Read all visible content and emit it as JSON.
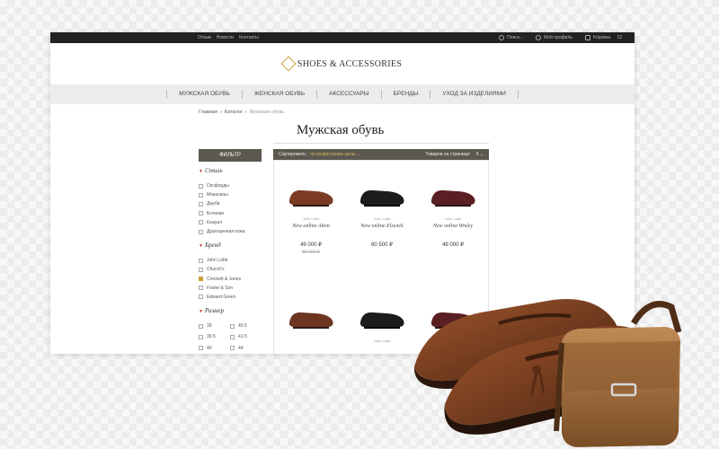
{
  "topbar": {
    "links": [
      "Отзыв",
      "Новости",
      "Контакты"
    ],
    "search_label": "Поиск...",
    "profile_label": "Мой профиль",
    "cart_label": "Корзина",
    "cart_count": "12"
  },
  "logo": {
    "text": "SHOES & ACCESSORIES",
    "accent": "#c9a033"
  },
  "nav": [
    "МУЖСКАЯ ОБУВЬ",
    "ЖЕНСКАЯ ОБУВЬ",
    "АКСЕССУАРЫ",
    "БРЕНДЫ",
    "УХОД ЗА ИЗДЕЛИЯМИ"
  ],
  "breadcrumb": {
    "home": "Главная",
    "catalog": "Каталог",
    "current": "Мужская обувь",
    "sep": "›"
  },
  "page_title": "Мужская обувь",
  "filter": {
    "button": "ФИЛЬТР",
    "style": {
      "title": "Стиль",
      "options": [
        "Оксфорды",
        "Мокасины",
        "Дерби",
        "Ботинки",
        "Кэжуал",
        "Драгоценная кожа"
      ]
    },
    "brand": {
      "title": "Бренд",
      "options": [
        "John Lobb",
        "Church's",
        "Crockett & Jones",
        "Foster & Son",
        "Edward Green"
      ],
      "checked": 2
    },
    "size": {
      "title": "Размер",
      "options": [
        "39",
        "40.5",
        "39.5",
        "41.5",
        "40",
        "44"
      ]
    }
  },
  "toolbar": {
    "sort_label": "Сортировать:",
    "sort_value": "по возрастанию цены",
    "per_page_label": "Товаров на странице:",
    "per_page_value": "9"
  },
  "products": [
    {
      "brand": "John Lobb",
      "name": "New online Alton",
      "price": "49 000 ₽",
      "old_price": "80 000 ₽",
      "color": "#7a3b22"
    },
    {
      "brand": "John Lobb",
      "name": "New online Elswick",
      "price": "60 500 ₽",
      "old_price": "",
      "color": "#1c1c1c"
    },
    {
      "brand": "John Lobb",
      "name": "New online Wisley",
      "price": "49 000 ₽",
      "old_price": "",
      "color": "#5a1f22"
    },
    {
      "brand": "",
      "name": "",
      "price": "",
      "old_price": "",
      "color": "#6b3520"
    },
    {
      "brand": "John Lobb",
      "name": "",
      "price": "",
      "old_price": "",
      "color": "#1c1c1c"
    },
    {
      "brand": "",
      "name": "",
      "price": "",
      "old_price": "",
      "color": "#5a1f22"
    }
  ]
}
